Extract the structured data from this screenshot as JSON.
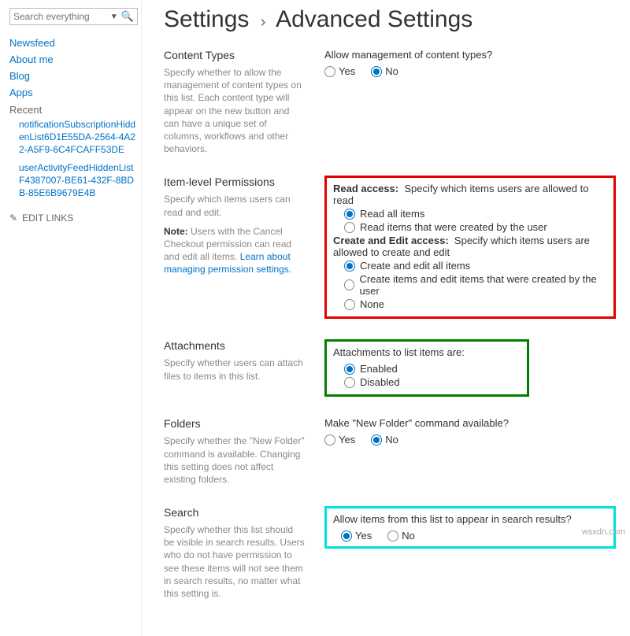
{
  "search": {
    "placeholder": "Search everything"
  },
  "nav": {
    "items": [
      "Newsfeed",
      "About me",
      "Blog",
      "Apps"
    ],
    "recent_label": "Recent",
    "recent": [
      "notificationSubscriptionHiddenList6D1E55DA-2564-4A22-A5F9-6C4FCAFF53DE",
      "userActivityFeedHiddenListF4387007-BE61-432F-8BDB-85E6B9679E4B"
    ],
    "edit": "EDIT LINKS"
  },
  "breadcrumb": {
    "a": "Settings",
    "b": "Advanced Settings"
  },
  "sections": {
    "content_types": {
      "title": "Content Types",
      "desc": "Specify whether to allow the management of content types on this list. Each content type will appear on the new button and can have a unique set of columns, workflows and other behaviors.",
      "q": "Allow management of content types?",
      "yes": "Yes",
      "no": "No"
    },
    "perms": {
      "title": "Item-level Permissions",
      "desc1": "Specify which items users can read and edit.",
      "note_label": "Note:",
      "note": " Users with the Cancel Checkout permission can read and edit all items. ",
      "link": "Learn about managing permission settings.",
      "read_label": "Read access:",
      "read_desc": "Specify which items users are allowed to read",
      "read_all": "Read all items",
      "read_own": "Read items that were created by the user",
      "create_label": "Create and Edit access:",
      "create_desc": "Specify which items users are allowed to create and edit",
      "create_all": "Create and edit all items",
      "create_own": "Create items and edit items that were created by the user",
      "none": "None"
    },
    "attach": {
      "title": "Attachments",
      "desc": "Specify whether users can attach files to items in this list.",
      "q": "Attachments to list items are:",
      "enabled": "Enabled",
      "disabled": "Disabled"
    },
    "folders": {
      "title": "Folders",
      "desc": "Specify whether the \"New Folder\" command is available. Changing this setting does not affect existing folders.",
      "q": "Make \"New Folder\" command available?",
      "yes": "Yes",
      "no": "No"
    },
    "search": {
      "title": "Search",
      "desc": "Specify whether this list should be visible in search results. Users who do not have permission to see these items will not see them in search results, no matter what this setting is.",
      "q": "Allow items from this list to appear in search results?",
      "yes": "Yes",
      "no": "No"
    }
  },
  "watermark": "wsxdn.com"
}
